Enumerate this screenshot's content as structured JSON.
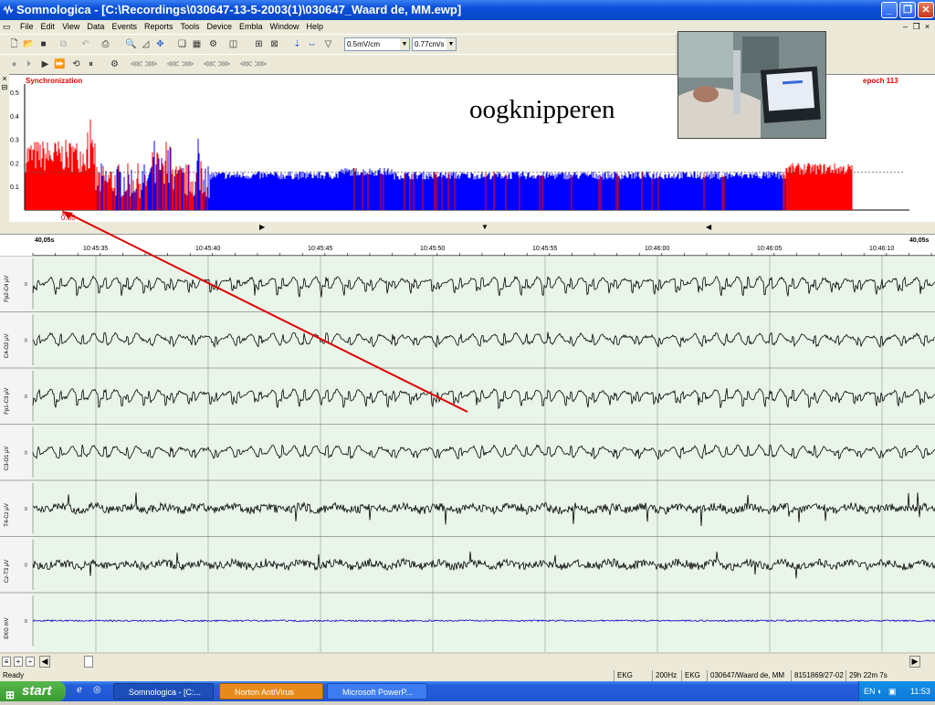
{
  "window": {
    "title": "Somnologica - [C:\\Recordings\\030647-13-5-2003(1)\\030647_Waard de, MM.ewp]"
  },
  "menu": [
    "File",
    "Edit",
    "View",
    "Data",
    "Events",
    "Reports",
    "Tools",
    "Device",
    "Embla",
    "Window",
    "Help"
  ],
  "toolbar": {
    "sensitivity": "0.5mV/cm",
    "speed": "0.77cm/s"
  },
  "sync": {
    "title": "Synchronization",
    "epoch": "epoch 113",
    "marker": "0.36",
    "yticks": [
      "0.5",
      "0.4",
      "0.3",
      "0.2",
      "0.1"
    ],
    "threshold": 0.16
  },
  "overlay_text": "oogknipperen",
  "timeaxis": {
    "left": "40,05s",
    "right": "40,05s",
    "ticks": [
      "10:45:35",
      "10:45:40",
      "10:45:45",
      "10:45:50",
      "10:45:55",
      "10:46:00",
      "10:46:05",
      "10:46:10"
    ]
  },
  "channels": [
    {
      "label": "Fp2-C4 µV",
      "zero": "0",
      "color": "#000000"
    },
    {
      "label": "C4-O2 µV",
      "zero": "0",
      "color": "#000000"
    },
    {
      "label": "Fp1-C3 µV",
      "zero": "0",
      "color": "#000000"
    },
    {
      "label": "C3-O1 µV",
      "zero": "0",
      "color": "#000000"
    },
    {
      "label": "T4-Cz µV",
      "zero": "0",
      "color": "#000000"
    },
    {
      "label": "Cz-T3 µV",
      "zero": "0",
      "color": "#000000"
    },
    {
      "label": "EKG mV",
      "zero": "0",
      "color": "#0000c0"
    }
  ],
  "status": {
    "text": "Ready",
    "fields": [
      "EKG",
      "200Hz",
      "EKG",
      "030647/Waard de, MM",
      "8151869/27-02",
      "29h 22m 7s"
    ]
  },
  "taskbar": {
    "start": "start",
    "tasks": [
      "Somnologica - [C:...",
      "Norton AntiVirus",
      "Microsoft PowerP..."
    ],
    "lang": "EN",
    "clock": "11:53"
  },
  "colors": {
    "burst": "#ff0000",
    "base": "#0000ff",
    "annotation": "#e00000"
  }
}
